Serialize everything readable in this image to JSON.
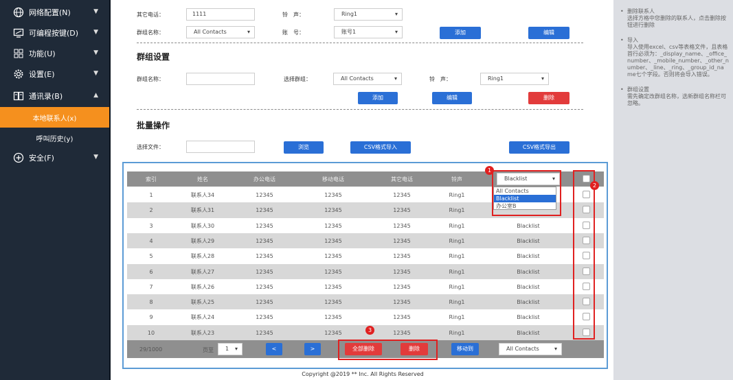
{
  "sidebar": {
    "items": [
      {
        "label": "网络配置(N)",
        "icon": "globe-icon",
        "chev": "▼"
      },
      {
        "label": "可编程按键(D)",
        "icon": "monitor-icon",
        "chev": "▼"
      },
      {
        "label": "功能(U)",
        "icon": "grid-icon",
        "chev": "▼"
      },
      {
        "label": "设置(E)",
        "icon": "gear-icon",
        "chev": "▼"
      },
      {
        "label": "通讯录(B)",
        "icon": "book-icon",
        "chev": "▲"
      }
    ],
    "sub_active": "本地联系人(x)",
    "sub_history": "呼叫历史(y)",
    "security": {
      "label": "安全(F)",
      "icon": "shield-plus-icon",
      "chev": "▼"
    }
  },
  "top_form": {
    "other_phone_label": "其它电话：",
    "other_phone_value": "1111",
    "ring_label": "铃　声：",
    "ring_value": "Ring1",
    "group_name_label": "群组名称：",
    "group_name_value": "All Contacts",
    "account_label": "账　号：",
    "account_value": "账号1",
    "add": "添加",
    "edit": "编辑"
  },
  "group_settings": {
    "title": "群组设置",
    "name_label": "群组名称：",
    "name_value": "",
    "select_label": "选择群组：",
    "select_value": "All Contacts",
    "ring_label": "铃　声：",
    "ring_value": "Ring1",
    "add": "添加",
    "edit": "编辑",
    "delete": "删除"
  },
  "batch": {
    "title": "批量操作",
    "file_label": "选择文件：",
    "file_value": "",
    "browse": "浏览",
    "import": "CSV格式导入",
    "export": "CSV格式导出"
  },
  "table": {
    "headers": [
      "索引",
      "姓名",
      "办公电话",
      "移动电话",
      "其它电话",
      "铃声"
    ],
    "group_select": "Blacklist",
    "dropdown_options": [
      "All Contacts",
      "Blacklist",
      "办公室B"
    ],
    "rows": [
      {
        "idx": "1",
        "name": "联系人34",
        "office": "12345",
        "mobile": "12345",
        "other": "12345",
        "ring": "Ring1",
        "group": ""
      },
      {
        "idx": "2",
        "name": "联系人31",
        "office": "12345",
        "mobile": "12345",
        "other": "12345",
        "ring": "Ring1",
        "group": ""
      },
      {
        "idx": "3",
        "name": "联系人30",
        "office": "12345",
        "mobile": "12345",
        "other": "12345",
        "ring": "Ring1",
        "group": "Blacklist"
      },
      {
        "idx": "4",
        "name": "联系人29",
        "office": "12345",
        "mobile": "12345",
        "other": "12345",
        "ring": "Ring1",
        "group": "Blacklist"
      },
      {
        "idx": "5",
        "name": "联系人28",
        "office": "12345",
        "mobile": "12345",
        "other": "12345",
        "ring": "Ring1",
        "group": "Blacklist"
      },
      {
        "idx": "6",
        "name": "联系人27",
        "office": "12345",
        "mobile": "12345",
        "other": "12345",
        "ring": "Ring1",
        "group": "Blacklist"
      },
      {
        "idx": "7",
        "name": "联系人26",
        "office": "12345",
        "mobile": "12345",
        "other": "12345",
        "ring": "Ring1",
        "group": "Blacklist"
      },
      {
        "idx": "8",
        "name": "联系人25",
        "office": "12345",
        "mobile": "12345",
        "other": "12345",
        "ring": "Ring1",
        "group": "Blacklist"
      },
      {
        "idx": "9",
        "name": "联系人24",
        "office": "12345",
        "mobile": "12345",
        "other": "12345",
        "ring": "Ring1",
        "group": "Blacklist"
      },
      {
        "idx": "10",
        "name": "联系人23",
        "office": "12345",
        "mobile": "12345",
        "other": "12345",
        "ring": "Ring1",
        "group": "Blacklist"
      }
    ],
    "footer": {
      "count": "29/1000",
      "page_label": "页至",
      "page_value": "1",
      "prev": "<",
      "next": ">",
      "delete_all": "全部删除",
      "delete": "删除",
      "move_to": "移动到",
      "move_target": "All Contacts"
    },
    "badges": [
      "1",
      "2",
      "3"
    ]
  },
  "help": [
    {
      "title": "删除联系人",
      "text": "选择方格中您删除的联系人，点击删除按钮进行删除"
    },
    {
      "title": "导入",
      "text": "导入使用excel、csv等表格文件，且表格首行必须为：_display_name、_office_number、_mobile_number、_other_number、_line、_ring、_group_id_name七个字段。否则将会导入错误。"
    },
    {
      "title": "群组设置",
      "text": "需先确定改群组名称，选新群组名称栏可忽略。"
    }
  ],
  "copyright": "Copyright @2019 ** Inc. All Rights Reserved",
  "colors": {
    "sidebar": "#1f2a38",
    "active": "#f5901e",
    "button_blue": "#2a6fd6",
    "button_red": "#e23b3b",
    "highlight": "#e02020"
  }
}
